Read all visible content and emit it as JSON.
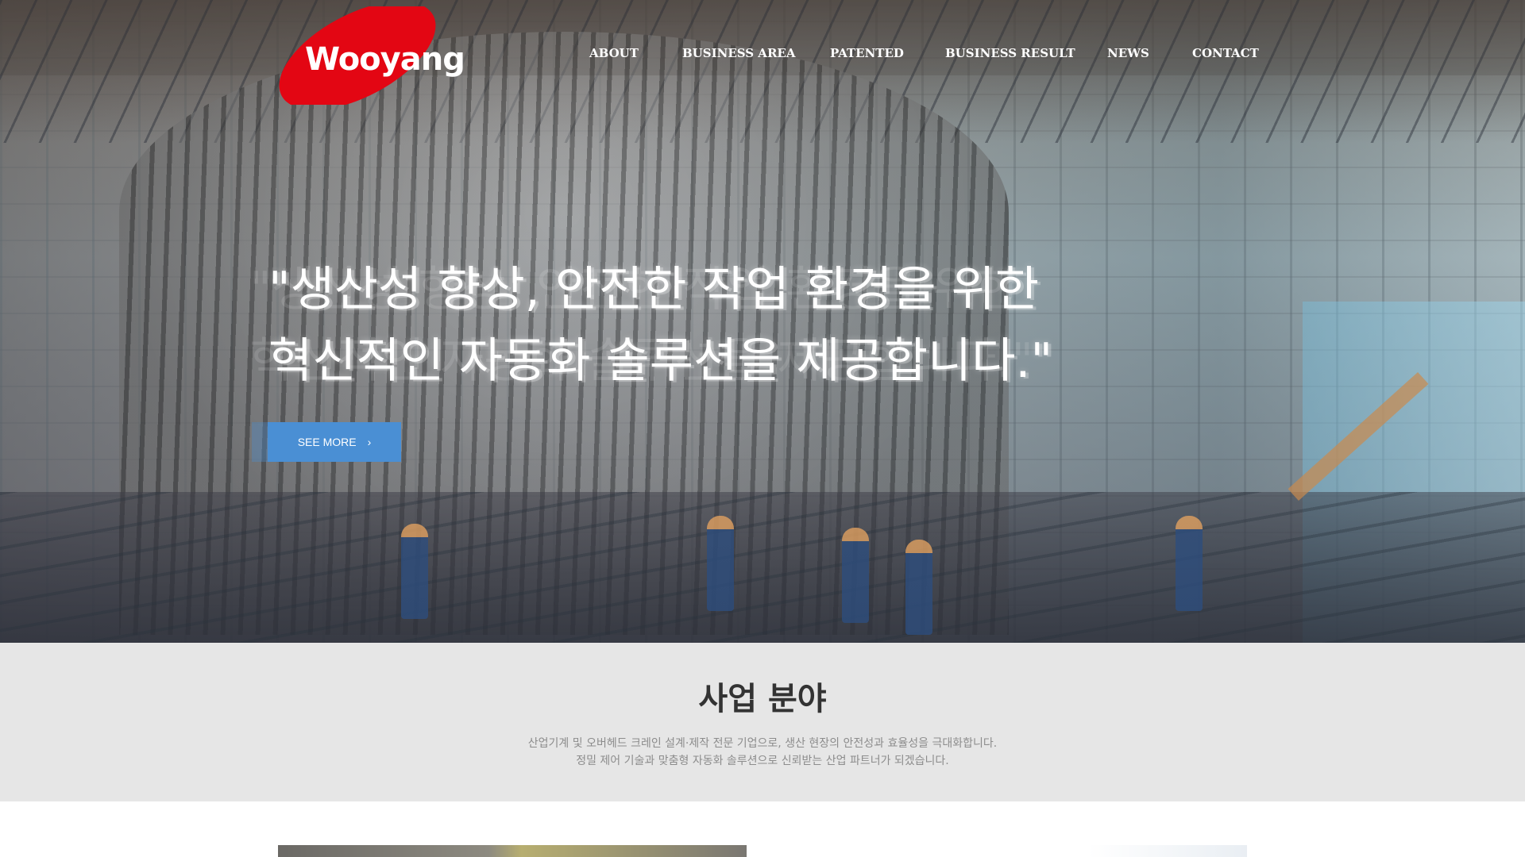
{
  "brand": {
    "logo_text": "Wooyang",
    "logo_color": "#e30613"
  },
  "nav": {
    "items": [
      {
        "label": "ABOUT"
      },
      {
        "label": "BUSINESS AREA"
      },
      {
        "label": "PATENTED"
      },
      {
        "label": "BUSINESS RESULT"
      },
      {
        "label": "NEWS"
      },
      {
        "label": "CONTACT"
      }
    ]
  },
  "hero": {
    "headline_line1": "\"생산성 향상, 안전한 작업 환경을 위한",
    "headline_line2": "혁신적인 자동화 솔루션을 제공합니다.\"",
    "cta_label": "SEE MORE",
    "cta_icon": "chevron-right-icon",
    "cta_color": "#4a8fd4"
  },
  "business": {
    "title": "사업 분야",
    "desc_line1": "산업기계 및 오버헤드 크레인 설계·제작 전문 기업으로, 생산 현장의 안전성과 효율성을 극대화합니다.",
    "desc_line2": "정밀 제어 기술과 맞춤형 자동화 솔루션으로 신뢰받는 산업 파트너가 되겠습니다."
  }
}
